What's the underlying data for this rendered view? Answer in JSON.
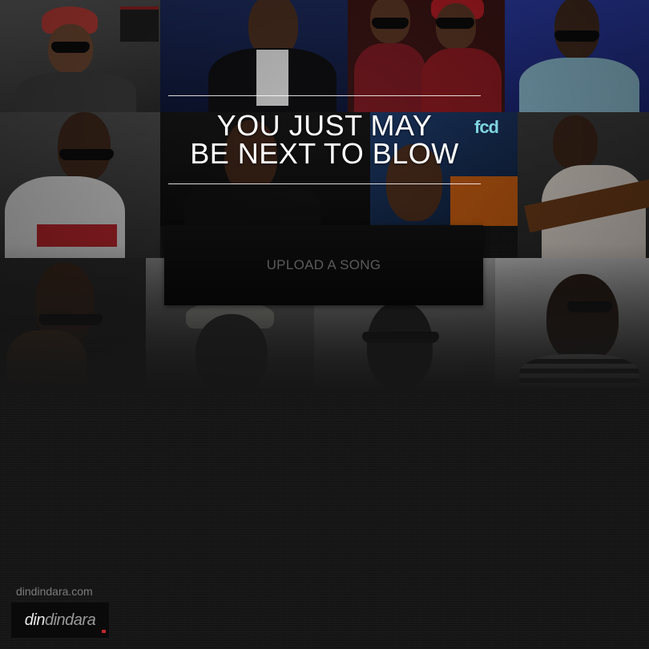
{
  "headline": {
    "line1": "YOU JUST MAY",
    "line2": "BE NEXT TO BLOW"
  },
  "upload_button": {
    "label": "UPLOAD A SONG"
  },
  "footer": {
    "site_url": "dindindara.com",
    "logo_part1": "din",
    "logo_part2": "dindara"
  },
  "photo_badge": {
    "text": "fcd"
  },
  "colors": {
    "background": "#161616",
    "headline": "#ffffff",
    "button_bg": "#0a0a0a",
    "button_text": "#5a5a5a",
    "footer_text": "#7c7c7c",
    "logo_accent": "#c0272d"
  }
}
